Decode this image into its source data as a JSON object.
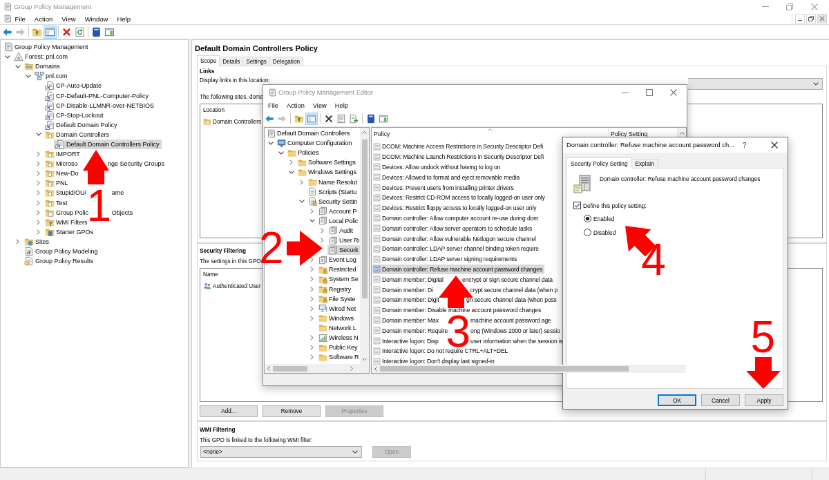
{
  "main_window": {
    "title": "Group Policy Management",
    "menu": [
      "File",
      "Action",
      "View",
      "Window",
      "Help"
    ],
    "toolbar": [
      [
        {
          "kind": "back",
          "disabled": false,
          "pressed": false
        },
        {
          "kind": "forward",
          "disabled": true,
          "pressed": false
        }
      ],
      [
        {
          "kind": "up",
          "disabled": false,
          "pressed": false
        },
        {
          "kind": "console-tree",
          "disabled": false,
          "pressed": true
        }
      ],
      [
        {
          "kind": "delete",
          "disabled": false,
          "pressed": false
        },
        {
          "kind": "refresh",
          "disabled": false,
          "pressed": false
        }
      ],
      [
        {
          "kind": "help",
          "disabled": false,
          "pressed": false
        },
        {
          "kind": "action-pane",
          "disabled": false,
          "pressed": false
        }
      ]
    ]
  },
  "console_tree": [
    {
      "label": "Group Policy Management",
      "kind": "console",
      "selected": false,
      "children": [
        {
          "label": "Forest: pnl.com",
          "kind": "forest",
          "expanded": true,
          "selected": false,
          "children": [
            {
              "label": "Domains",
              "kind": "domains",
              "expanded": true,
              "selected": false,
              "children": [
                {
                  "label": "pnl.com",
                  "kind": "domain",
                  "expanded": true,
                  "selected": false,
                  "children": [
                    {
                      "label": "CP-Auto-Update",
                      "kind": "gpo-link",
                      "selected": false
                    },
                    {
                      "label": "CP-Default-PNL-Computer-Policy",
                      "kind": "gpo-link",
                      "selected": false
                    },
                    {
                      "label": "CP-Disable-LLMNR-over-NETBIOS",
                      "kind": "gpo-link",
                      "selected": false
                    },
                    {
                      "label": "CP-Stop-Lockout",
                      "kind": "gpo-link",
                      "selected": false
                    },
                    {
                      "label": "Default Domain Policy",
                      "kind": "gpo-link",
                      "selected": false
                    },
                    {
                      "label": "Domain Controllers",
                      "kind": "ou",
                      "expanded": true,
                      "selected": false,
                      "children": [
                        {
                          "label": "Default Domain Controllers Policy",
                          "kind": "gpo-link",
                          "selected": true
                        }
                      ]
                    },
                    {
                      "label": "IMPORT",
                      "kind": "ou",
                      "expanded": false,
                      "selected": false
                    },
                    {
                      "label": [
                        "Microso",
                        "nge Security Groups"
                      ],
                      "kind": "ou",
                      "expanded": false,
                      "selected": false
                    },
                    {
                      "label": "New-Do",
                      "kind": "ou",
                      "expanded": false,
                      "selected": false
                    },
                    {
                      "label": "PNL",
                      "kind": "ou",
                      "expanded": false,
                      "selected": false
                    },
                    {
                      "label": [
                        "Stupid/OU/",
                        "ame"
                      ],
                      "kind": "ou",
                      "expanded": false,
                      "selected": false
                    },
                    {
                      "label": "Test",
                      "kind": "ou",
                      "expanded": false,
                      "selected": false
                    },
                    {
                      "label": [
                        "Group Polic",
                        "Objects"
                      ],
                      "kind": "gpo-container",
                      "expanded": false,
                      "selected": false
                    },
                    {
                      "label": "WMI Filters",
                      "kind": "wmi",
                      "expanded": false,
                      "selected": false
                    },
                    {
                      "label": "Starter GPOs",
                      "kind": "starter",
                      "expanded": false,
                      "selected": false
                    }
                  ]
                }
              ]
            },
            {
              "label": "Sites",
              "kind": "sites",
              "expanded": false,
              "selected": false
            },
            {
              "label": "Group Policy Modeling",
              "kind": "modeling",
              "selected": false
            },
            {
              "label": "Group Policy Results",
              "kind": "results",
              "selected": false
            }
          ]
        }
      ]
    }
  ],
  "gpo_pane": {
    "title": "Default Domain Controllers Policy",
    "tabs": [
      {
        "label": "Scope",
        "selected": true
      },
      {
        "label": "Details",
        "selected": false
      },
      {
        "label": "Settings",
        "selected": false
      },
      {
        "label": "Delegation",
        "selected": false
      }
    ],
    "links": {
      "heading": "Links",
      "location_label": "Display links in this location:",
      "description": "The following sites, doma",
      "columns": [
        "Location"
      ],
      "rows": [
        {
          "kind": "ou",
          "name": "Domain Controllers"
        }
      ]
    },
    "security_filtering": {
      "heading": "Security Filtering",
      "description": "The settings in this GPO",
      "columns": [
        "Name"
      ],
      "rows": [
        {
          "kind": "user-group",
          "name": "Authenticated User"
        }
      ],
      "buttons": [
        {
          "label": "Add...",
          "disabled": false
        },
        {
          "label": "Remove",
          "disabled": false
        },
        {
          "label": "Properties",
          "disabled": true
        }
      ]
    },
    "wmi_filtering": {
      "heading": "WMI Filtering",
      "description": "This GPO is linked to the following WMI filter:",
      "filter_value": "<none>",
      "open_button": {
        "label": "Open",
        "disabled": true
      }
    }
  },
  "editor_window": {
    "title": "Group Policy Management Editor",
    "menu": [
      "File",
      "Action",
      "View",
      "Help"
    ],
    "toolbar": [
      [
        {
          "kind": "back",
          "disabled": false,
          "pressed": false
        },
        {
          "kind": "forward",
          "disabled": true,
          "pressed": false
        }
      ],
      [
        {
          "kind": "up",
          "disabled": false,
          "pressed": false
        },
        {
          "kind": "console-tree",
          "disabled": false,
          "pressed": true
        }
      ],
      [
        {
          "kind": "remove",
          "disabled": false,
          "pressed": false
        },
        {
          "kind": "properties",
          "disabled": false,
          "pressed": false
        },
        {
          "kind": "export",
          "disabled": false,
          "pressed": false
        }
      ],
      [
        {
          "kind": "help",
          "disabled": false,
          "pressed": false
        },
        {
          "kind": "action-pane",
          "disabled": false,
          "pressed": false
        }
      ]
    ],
    "tree": [
      {
        "label": "Default Domain Controllers",
        "kind": "scroll",
        "selected": false,
        "children": [
          {
            "label": "Computer Configuration",
            "kind": "computer",
            "expanded": true,
            "selected": false,
            "children": [
              {
                "label": "Policies",
                "kind": "folder",
                "expanded": true,
                "selected": false,
                "children": [
                  {
                    "label": "Software Settings",
                    "kind": "folder",
                    "expanded": false,
                    "selected": false
                  },
                  {
                    "label": "Windows Settings",
                    "kind": "folder",
                    "expanded": true,
                    "selected": false,
                    "children": [
                      {
                        "label": "Name Resolut",
                        "kind": "folder",
                        "expanded": false,
                        "selected": false
                      },
                      {
                        "label": "Scripts (Startu",
                        "kind": "script",
                        "selected": false
                      },
                      {
                        "label": "Security Settin",
                        "kind": "security",
                        "expanded": true,
                        "selected": false,
                        "children": [
                          {
                            "label": "Account P",
                            "kind": "policy-stack",
                            "expanded": false,
                            "selected": false
                          },
                          {
                            "label": "Local Polic",
                            "kind": "policy-stack",
                            "expanded": true,
                            "selected": false,
                            "children": [
                              {
                                "label": "Audit",
                                "kind": "policy-stack",
                                "expanded": false,
                                "selected": false
                              },
                              {
                                "label": "User Ri",
                                "kind": "policy-stack",
                                "expanded": false,
                                "selected": false
                              },
                              {
                                "label": "Securit",
                                "kind": "policy-stack",
                                "selected": true
                              }
                            ]
                          },
                          {
                            "label": "Event Log",
                            "kind": "policy-stack",
                            "expanded": false,
                            "selected": false
                          },
                          {
                            "label": "Restricted",
                            "kind": "lock-folder",
                            "expanded": false,
                            "selected": false
                          },
                          {
                            "label": "System Se",
                            "kind": "lock-folder",
                            "expanded": false,
                            "selected": false
                          },
                          {
                            "label": "Registry",
                            "kind": "lock-folder",
                            "expanded": false,
                            "selected": false
                          },
                          {
                            "label": "File Syste",
                            "kind": "lock-folder",
                            "expanded": false,
                            "selected": false
                          },
                          {
                            "label": "Wired Net",
                            "kind": "wired",
                            "expanded": false,
                            "selected": false
                          },
                          {
                            "label": "Windows",
                            "kind": "folder",
                            "expanded": false,
                            "selected": false
                          },
                          {
                            "label": "Network L",
                            "kind": "folder",
                            "selected": false
                          },
                          {
                            "label": "Wireless N",
                            "kind": "wireless",
                            "expanded": false,
                            "selected": false
                          },
                          {
                            "label": "Public Key",
                            "kind": "folder",
                            "expanded": false,
                            "selected": false
                          },
                          {
                            "label": "Software R",
                            "kind": "folder",
                            "expanded": false,
                            "selected": false
                          }
                        ]
                      }
                    ]
                  }
                ]
              }
            ]
          }
        ]
      }
    ],
    "columns": [
      "Policy",
      "Policy Setting"
    ],
    "policies": [
      {
        "name": "DCOM: Machine Access Restrictions in Security Descriptor Defi",
        "selected": false
      },
      {
        "name": "DCOM: Machine Launch Restrictions in Security Descriptor Defi",
        "selected": false
      },
      {
        "name": "Devices: Allow undock without having to log on",
        "selected": false
      },
      {
        "name": "Devices: Allowed to format and eject removable media",
        "selected": false
      },
      {
        "name": "Devices: Prevent users from installing printer drivers",
        "selected": false
      },
      {
        "name": "Devices: Restrict CD-ROM access to locally logged-on user only",
        "selected": false
      },
      {
        "name": "Devices: Restrict floppy access to locally logged-on user only",
        "selected": false
      },
      {
        "name": "Domain controller: Allow computer account re-use during dom",
        "selected": false
      },
      {
        "name": "Domain controller: Allow server operators to schedule tasks",
        "selected": false
      },
      {
        "name": "Domain controller: Allow vulnerable Netlogon secure channel",
        "selected": false
      },
      {
        "name": "Domain controller: LDAP server channel binding token require",
        "selected": false
      },
      {
        "name": "Domain controller: LDAP server signing requirements",
        "selected": false
      },
      {
        "name": "Domain controller: Refuse machine account password changes",
        "selected": true
      },
      {
        "name": [
          "Domain member: Digital",
          "encrypt or sign secure channel data"
        ],
        "selected": false
      },
      {
        "name": [
          "Domain member: Di",
          "crypt secure channel data (when p"
        ],
        "selected": false
      },
      {
        "name": [
          "Domain member: Digit",
          "gn secure channel data (when poss"
        ],
        "selected": false
      },
      {
        "name": "Domain member: Disable machine account password changes",
        "selected": false
      },
      {
        "name": [
          "Domain member: Max",
          "machine account password age"
        ],
        "selected": false
      },
      {
        "name": [
          "Domain member: Require",
          "ong (Windows 2000 or later) sessio"
        ],
        "selected": false
      },
      {
        "name": [
          "Interactive logon: Disp",
          "user information when the session is"
        ],
        "selected": false
      },
      {
        "name": "Interactive logon: Do not require CTRL+ALT+DEL",
        "selected": false
      },
      {
        "name": "Interactive logon: Don't display last signed-in",
        "selected": false
      }
    ]
  },
  "dialog": {
    "title": "Domain controller: Refuse machine account password ch...",
    "help_button": "?",
    "tabs": [
      {
        "label": "Security Policy Setting",
        "selected": true
      },
      {
        "label": "Explain",
        "selected": false
      }
    ],
    "policy_name": "Domain controller: Refuse machine account password changes",
    "define_setting": {
      "label": "Define this policy setting:",
      "checked": true
    },
    "options": [
      {
        "label": "Enabled",
        "selected": true
      },
      {
        "label": "Disabled",
        "selected": false
      }
    ],
    "buttons": [
      {
        "label": "OK",
        "default": true
      },
      {
        "label": "Cancel",
        "default": false
      },
      {
        "label": "Apply",
        "default": false
      }
    ]
  },
  "annotations": [
    {
      "number": "1",
      "kind": "up"
    },
    {
      "number": "2",
      "kind": "right"
    },
    {
      "number": "3",
      "kind": "up"
    },
    {
      "number": "4",
      "kind": "up-left"
    },
    {
      "number": "5",
      "kind": "down"
    }
  ]
}
